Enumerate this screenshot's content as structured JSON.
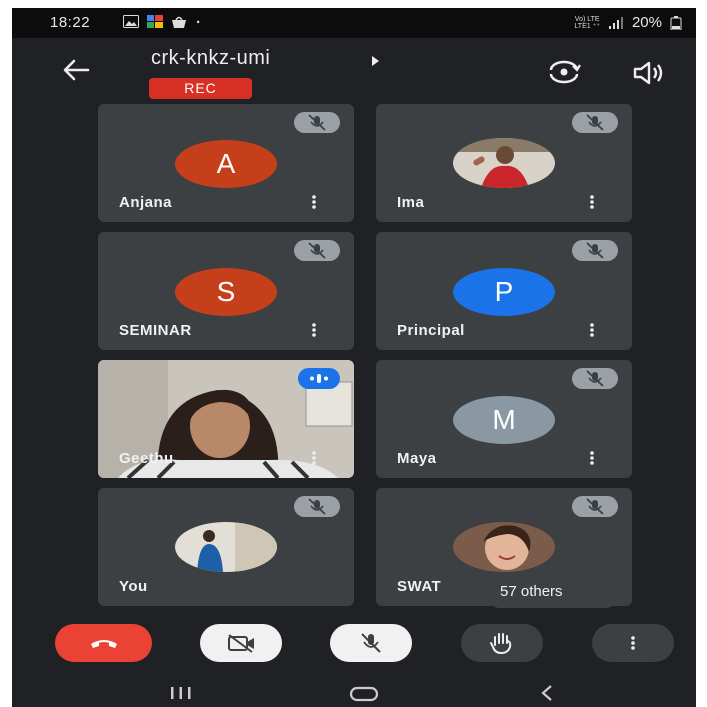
{
  "status_bar": {
    "time": "18:22",
    "network": "Vo) LTE\nLTE1 ⁺⁺",
    "battery": "20%",
    "notification_icons": [
      "image-icon",
      "gallery-icon",
      "bag-icon",
      "dot-icon"
    ]
  },
  "meeting": {
    "title": "crk-knkz-umi",
    "rec_label": "REC"
  },
  "colors": {
    "background": "#202124",
    "tile": "#3c4043",
    "rec": "#d93025",
    "end_call": "#ea4335",
    "avatar_orange": "#c5401a",
    "avatar_blue": "#1a73e8",
    "avatar_grey": "#8a98a3"
  },
  "participants": [
    {
      "name": "Anjana",
      "initial": "A",
      "avatar_color": "#c5401a",
      "muted": true
    },
    {
      "name": "Ima",
      "initial": "",
      "avatar_color": "#b33",
      "muted": true
    },
    {
      "name": "SEMINAR",
      "initial": "S",
      "avatar_color": "#c5401a",
      "muted": true
    },
    {
      "name": "Principal",
      "initial": "P",
      "avatar_color": "#1a73e8",
      "muted": true
    },
    {
      "name": "Geethu",
      "initial": "",
      "avatar_color": "",
      "muted": false,
      "speaking": true
    },
    {
      "name": "Maya",
      "initial": "M",
      "avatar_color": "#8a98a3",
      "muted": true
    },
    {
      "name": "You",
      "initial": "",
      "avatar_color": "",
      "muted": true
    },
    {
      "name": "SWAT",
      "initial": "",
      "avatar_color": "",
      "muted": true
    }
  ],
  "others_label": "57 others",
  "controls": [
    "end-call",
    "camera-off",
    "mic-off",
    "raise-hand",
    "more-options"
  ]
}
